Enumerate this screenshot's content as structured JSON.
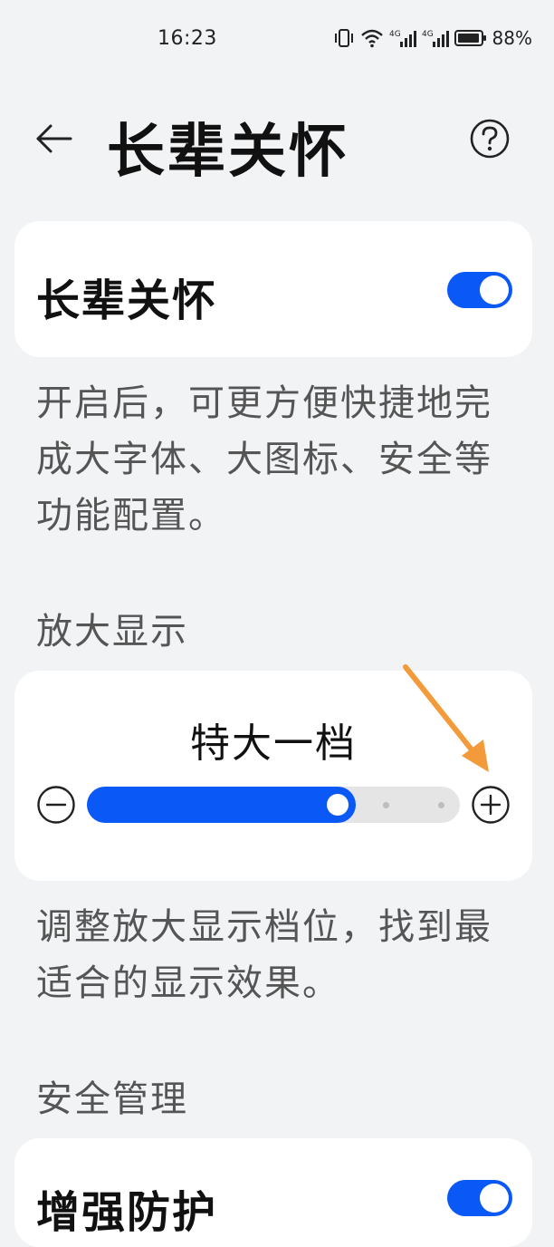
{
  "status_bar": {
    "time": "16:23",
    "battery": "88%",
    "icons": [
      "vibrate-icon",
      "wifi-icon",
      "signal-4g-icon",
      "signal-4g-icon",
      "battery-icon"
    ]
  },
  "header": {
    "title": "长辈关怀",
    "back_icon": "back-arrow-icon",
    "help_icon": "help-icon"
  },
  "elder_care": {
    "label": "长辈关怀",
    "enabled": true,
    "description": "开启后，可更方便快捷地完成大字体、大图标、安全等功能配置。"
  },
  "zoom": {
    "section_title": "放大显示",
    "level_label": "特大一档",
    "slider_value": 0.72,
    "minus_icon": "minus-circle-icon",
    "plus_icon": "plus-circle-icon",
    "description": "调整放大显示档位，找到最适合的显示效果。"
  },
  "safety": {
    "section_title": "安全管理",
    "item_label": "增强防护"
  },
  "colors": {
    "accent": "#0a59f7",
    "background": "#f1f3f5",
    "card": "#ffffff",
    "annotation": "#f39a3b"
  }
}
